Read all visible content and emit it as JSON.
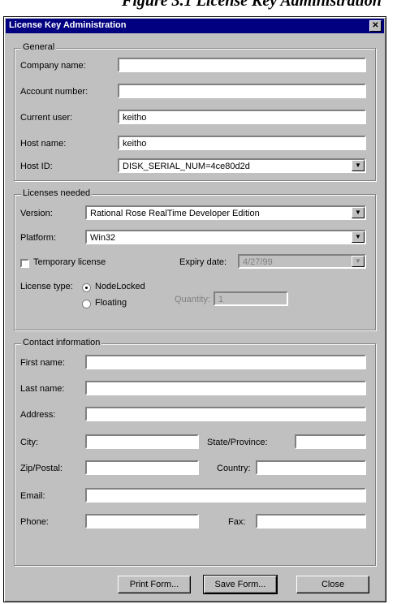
{
  "header_text": "Figure 3.1 License Key Administration",
  "window": {
    "title": "License Key Administration",
    "close_glyph": "✕"
  },
  "general": {
    "legend": "General",
    "company_name": {
      "label": "Company name:",
      "value": ""
    },
    "account_number": {
      "label": "Account number:",
      "value": ""
    },
    "current_user": {
      "label": "Current user:",
      "value": "keitho"
    },
    "host_name": {
      "label": "Host name:",
      "value": "keitho"
    },
    "host_id": {
      "label": "Host ID:",
      "value": "DISK_SERIAL_NUM=4ce80d2d"
    }
  },
  "licenses": {
    "legend": "Licenses needed",
    "version": {
      "label": "Version:",
      "value": "Rational Rose RealTime Developer Edition"
    },
    "platform": {
      "label": "Platform:",
      "value": "Win32"
    },
    "temporary_license": {
      "label": "Temporary license",
      "checked": false
    },
    "expiry_date": {
      "label": "Expiry date:",
      "value": "4/27/99"
    },
    "license_type": {
      "label": "License type:",
      "options": [
        {
          "label": "NodeLocked",
          "selected": true
        },
        {
          "label": "Floating",
          "selected": false
        }
      ]
    },
    "quantity": {
      "label": "Quantity:",
      "value": "1"
    }
  },
  "contact": {
    "legend": "Contact information",
    "first_name": {
      "label": "First name:",
      "value": ""
    },
    "last_name": {
      "label": "Last name:",
      "value": ""
    },
    "address": {
      "label": "Address:",
      "value": ""
    },
    "city": {
      "label": "City:",
      "value": ""
    },
    "state": {
      "label": "State/Province:",
      "value": ""
    },
    "zip": {
      "label": "Zip/Postal:",
      "value": ""
    },
    "country": {
      "label": "Country:",
      "value": ""
    },
    "email": {
      "label": "Email:",
      "value": ""
    },
    "phone": {
      "label": "Phone:",
      "value": ""
    },
    "fax": {
      "label": "Fax:",
      "value": ""
    }
  },
  "buttons": {
    "print": "Print Form...",
    "save": "Save Form...",
    "close": "Close"
  },
  "icons": {
    "combo_arrow": "▼"
  }
}
